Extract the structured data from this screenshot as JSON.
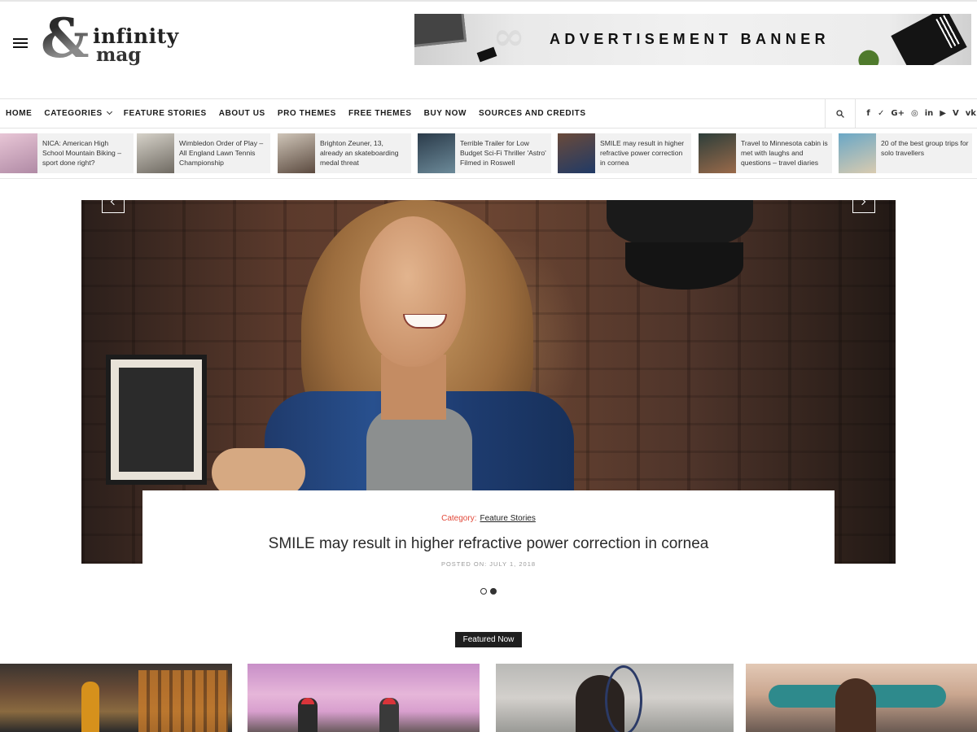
{
  "site": {
    "logo_mark": "&",
    "logo_word1": "infinity",
    "logo_word2": "mag"
  },
  "ad_banner": {
    "text": "ADVERTISEMENT BANNER",
    "watermark": "infinity mag"
  },
  "nav": {
    "items": [
      {
        "label": "HOME"
      },
      {
        "label": "CATEGORIES",
        "has_dropdown": true
      },
      {
        "label": "FEATURE STORIES"
      },
      {
        "label": "ABOUT US"
      },
      {
        "label": "PRO THEMES"
      },
      {
        "label": "FREE THEMES"
      },
      {
        "label": "BUY NOW"
      },
      {
        "label": "SOURCES AND CREDITS"
      }
    ],
    "search_icon": "search-icon",
    "socials": [
      {
        "icon": "facebook-icon",
        "glyph": "f"
      },
      {
        "icon": "twitter-icon",
        "glyph": "✓"
      },
      {
        "icon": "google-plus-icon",
        "glyph": "G+"
      },
      {
        "icon": "instagram-icon",
        "glyph": "◎"
      },
      {
        "icon": "linkedin-icon",
        "glyph": "in"
      },
      {
        "icon": "youtube-icon",
        "glyph": "▶"
      },
      {
        "icon": "vimeo-icon",
        "glyph": "V"
      },
      {
        "icon": "vk-icon",
        "glyph": "vk"
      }
    ]
  },
  "ticker": [
    {
      "text": "NICA: American High School Mountain Biking – sport done right?",
      "thumb": [
        "#e8c6d6",
        "#b08aa5"
      ]
    },
    {
      "text": "Wimbledon Order of Play – All England Lawn Tennis Championship",
      "thumb": [
        "#d6d2c9",
        "#6f6a62"
      ]
    },
    {
      "text": "Brighton Zeuner, 13, already an skateboarding medal threat",
      "thumb": [
        "#cfc5b8",
        "#5b4a3f"
      ]
    },
    {
      "text": "Terrible Trailer for Low Budget Sci-Fi Thriller 'Astro' Filmed in Roswell",
      "thumb": [
        "#2b3b4a",
        "#6c8a99"
      ]
    },
    {
      "text": "SMILE may result in higher refractive power correction in cornea",
      "thumb": [
        "#6a4a3a",
        "#203a66"
      ]
    },
    {
      "text": "Travel to Minnesota cabin is met with laughs and questions – travel diaries",
      "thumb": [
        "#2d3e3a",
        "#9a6a4a"
      ]
    },
    {
      "text": "20 of the best group trips for solo travellers",
      "thumb": [
        "#6aa7c6",
        "#d9cbb0"
      ]
    }
  ],
  "hero": {
    "category_label": "Category:",
    "category_value": "Feature Stories",
    "title": "SMILE may result in higher refractive power correction in cornea",
    "posted": "POSTED ON: JULY 1, 2018",
    "slides_total": 2,
    "active_slide": 2
  },
  "featured": {
    "label": "Featured Now"
  },
  "colors": {
    "accent": "#e2493a",
    "dark": "#1e1e1e"
  }
}
